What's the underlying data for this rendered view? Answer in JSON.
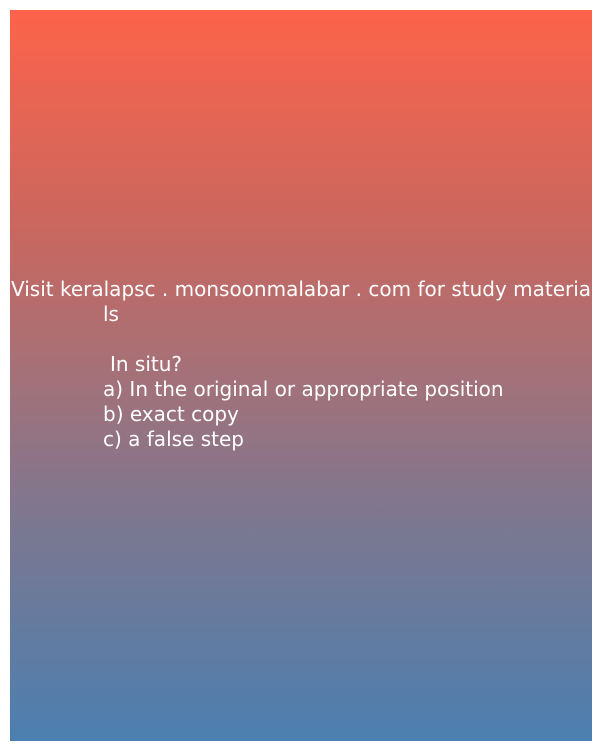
{
  "promo": {
    "line1": "Visit keralapsc . monsoonmalabar . com for study materia",
    "line2": "ls"
  },
  "question": {
    "text": "In situ?",
    "options": [
      "a) In the original or appropriate position",
      "b) exact copy",
      "c) a false step"
    ]
  },
  "colors": {
    "gradient_top": "#fd634a",
    "gradient_bottom": "#4b7fb0",
    "text": "#ffffff"
  }
}
